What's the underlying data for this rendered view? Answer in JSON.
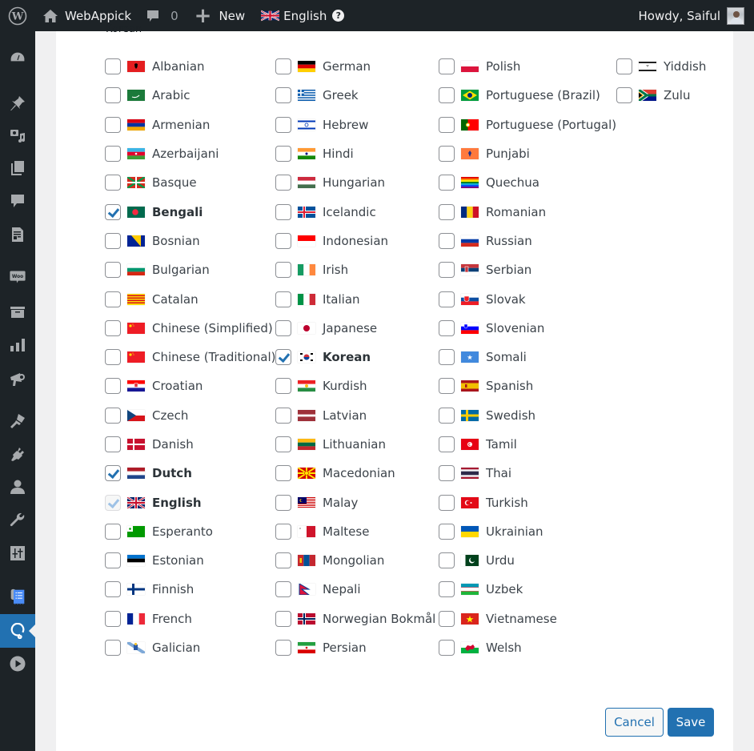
{
  "adminbar": {
    "site_name": "WebAppick",
    "comments_count": "0",
    "new_label": "New",
    "language_label": "English",
    "help_label": "?",
    "greeting": "Howdy, Saiful"
  },
  "sidebar": {
    "items": [
      {
        "icon": "dashboard-icon"
      },
      {
        "icon": "pin-icon"
      },
      {
        "icon": "media-icon"
      },
      {
        "icon": "pages-icon"
      },
      {
        "icon": "comments-icon"
      },
      {
        "icon": "document-icon"
      },
      {
        "icon": "woocommerce-icon"
      },
      {
        "icon": "archive-icon"
      },
      {
        "icon": "analytics-icon"
      },
      {
        "icon": "megaphone-icon"
      },
      {
        "icon": "appearance-icon"
      },
      {
        "icon": "plugins-icon"
      },
      {
        "icon": "users-icon"
      },
      {
        "icon": "tools-icon"
      },
      {
        "icon": "settings-icon"
      },
      {
        "icon": "list-plugin-icon"
      },
      {
        "icon": "translate-plugin-icon",
        "active": true
      },
      {
        "icon": "play-icon"
      }
    ]
  },
  "panel": {
    "cut_label": "Korean",
    "columns": [
      [
        {
          "label": "Albanian",
          "flag": "al"
        },
        {
          "label": "Arabic",
          "flag": "ar"
        },
        {
          "label": "Armenian",
          "flag": "am"
        },
        {
          "label": "Azerbaijani",
          "flag": "az"
        },
        {
          "label": "Basque",
          "flag": "eu"
        },
        {
          "label": "Bengali",
          "flag": "bd",
          "checked": true
        },
        {
          "label": "Bosnian",
          "flag": "ba"
        },
        {
          "label": "Bulgarian",
          "flag": "bg"
        },
        {
          "label": "Catalan",
          "flag": "ca"
        },
        {
          "label": "Chinese (Simplified)",
          "flag": "cn"
        },
        {
          "label": "Chinese (Traditional)",
          "flag": "cn"
        },
        {
          "label": "Croatian",
          "flag": "hr"
        },
        {
          "label": "Czech",
          "flag": "cz"
        },
        {
          "label": "Danish",
          "flag": "dk"
        },
        {
          "label": "Dutch",
          "flag": "nl",
          "checked": true
        },
        {
          "label": "English",
          "flag": "gb",
          "checked": true,
          "disabled": true
        },
        {
          "label": "Esperanto",
          "flag": "eo"
        },
        {
          "label": "Estonian",
          "flag": "ee"
        },
        {
          "label": "Finnish",
          "flag": "fi"
        },
        {
          "label": "French",
          "flag": "fr"
        },
        {
          "label": "Galician",
          "flag": "gl"
        }
      ],
      [
        {
          "label": "German",
          "flag": "de"
        },
        {
          "label": "Greek",
          "flag": "gr"
        },
        {
          "label": "Hebrew",
          "flag": "il"
        },
        {
          "label": "Hindi",
          "flag": "in"
        },
        {
          "label": "Hungarian",
          "flag": "hu"
        },
        {
          "label": "Icelandic",
          "flag": "is"
        },
        {
          "label": "Indonesian",
          "flag": "id"
        },
        {
          "label": "Irish",
          "flag": "ie"
        },
        {
          "label": "Italian",
          "flag": "it"
        },
        {
          "label": "Japanese",
          "flag": "jp"
        },
        {
          "label": "Korean",
          "flag": "kr",
          "checked": true
        },
        {
          "label": "Kurdish",
          "flag": "ku"
        },
        {
          "label": "Latvian",
          "flag": "lv"
        },
        {
          "label": "Lithuanian",
          "flag": "lt"
        },
        {
          "label": "Macedonian",
          "flag": "mk"
        },
        {
          "label": "Malay",
          "flag": "my"
        },
        {
          "label": "Maltese",
          "flag": "mt"
        },
        {
          "label": "Mongolian",
          "flag": "mn"
        },
        {
          "label": "Nepali",
          "flag": "np"
        },
        {
          "label": "Norwegian Bokmål",
          "flag": "no"
        },
        {
          "label": "Persian",
          "flag": "ir"
        }
      ],
      [
        {
          "label": "Polish",
          "flag": "pl"
        },
        {
          "label": "Portuguese (Brazil)",
          "flag": "br"
        },
        {
          "label": "Portuguese (Portugal)",
          "flag": "pt"
        },
        {
          "label": "Punjabi",
          "flag": "pa"
        },
        {
          "label": "Quechua",
          "flag": "qu"
        },
        {
          "label": "Romanian",
          "flag": "ro"
        },
        {
          "label": "Russian",
          "flag": "ru"
        },
        {
          "label": "Serbian",
          "flag": "rs"
        },
        {
          "label": "Slovak",
          "flag": "sk"
        },
        {
          "label": "Slovenian",
          "flag": "si"
        },
        {
          "label": "Somali",
          "flag": "so"
        },
        {
          "label": "Spanish",
          "flag": "es"
        },
        {
          "label": "Swedish",
          "flag": "se"
        },
        {
          "label": "Tamil",
          "flag": "ta"
        },
        {
          "label": "Thai",
          "flag": "th"
        },
        {
          "label": "Turkish",
          "flag": "tr"
        },
        {
          "label": "Ukrainian",
          "flag": "ua"
        },
        {
          "label": "Urdu",
          "flag": "pk"
        },
        {
          "label": "Uzbek",
          "flag": "uz"
        },
        {
          "label": "Vietnamese",
          "flag": "vn"
        },
        {
          "label": "Welsh",
          "flag": "cy"
        }
      ],
      [
        {
          "label": "Yiddish",
          "flag": "yi"
        },
        {
          "label": "Zulu",
          "flag": "za"
        }
      ]
    ],
    "cancel_label": "Cancel",
    "save_label": "Save"
  },
  "colors": {
    "adminbar_bg": "#1d2327",
    "accent": "#2271b1",
    "panel_bg": "#ffffff",
    "page_bg": "#f0f0f1"
  }
}
